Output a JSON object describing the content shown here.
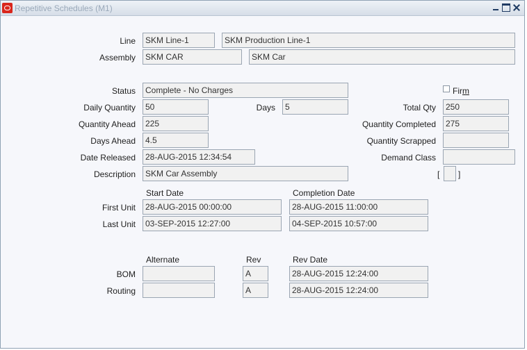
{
  "window": {
    "title": "Repetitive Schedules (M1)"
  },
  "labels": {
    "line": "Line",
    "assembly": "Assembly",
    "status": "Status",
    "daily_quantity": "Daily Quantity",
    "days": "Days",
    "total_qty": "Total Qty",
    "quantity_ahead": "Quantity Ahead",
    "quantity_completed": "Quantity Completed",
    "days_ahead": "Days Ahead",
    "quantity_scrapped": "Quantity Scrapped",
    "date_released": "Date Released",
    "demand_class": "Demand Class",
    "description": "Description",
    "start_date": "Start Date",
    "completion_date": "Completion Date",
    "first_unit": "First Unit",
    "last_unit": "Last Unit",
    "alternate": "Alternate",
    "rev": "Rev",
    "rev_date": "Rev Date",
    "bom": "BOM",
    "routing": "Routing",
    "firm_prefix": "Fir",
    "firm_mnemonic": "m",
    "bracket_open": "[",
    "bracket_close": "]"
  },
  "values": {
    "line_code": "SKM Line-1",
    "line_desc": "SKM Production Line-1",
    "assembly_code": "SKM CAR",
    "assembly_desc": "SKM Car",
    "status": "Complete - No Charges",
    "daily_quantity": "50",
    "days": "5",
    "total_qty": "250",
    "quantity_ahead": "225",
    "quantity_completed": "275",
    "days_ahead": "4.5",
    "quantity_scrapped": "",
    "date_released": "28-AUG-2015 12:34:54",
    "demand_class": "",
    "description": "SKM Car Assembly",
    "first_unit_start": "28-AUG-2015 00:00:00",
    "first_unit_completion": "28-AUG-2015 11:00:00",
    "last_unit_start": "03-SEP-2015 12:27:00",
    "last_unit_completion": "04-SEP-2015 10:57:00",
    "bom_alternate": "",
    "bom_rev": "A",
    "bom_rev_date": "28-AUG-2015 12:24:00",
    "routing_alternate": "",
    "routing_rev": "A",
    "routing_rev_date": "28-AUG-2015 12:24:00",
    "flex_field": "",
    "firm_checked": false
  }
}
